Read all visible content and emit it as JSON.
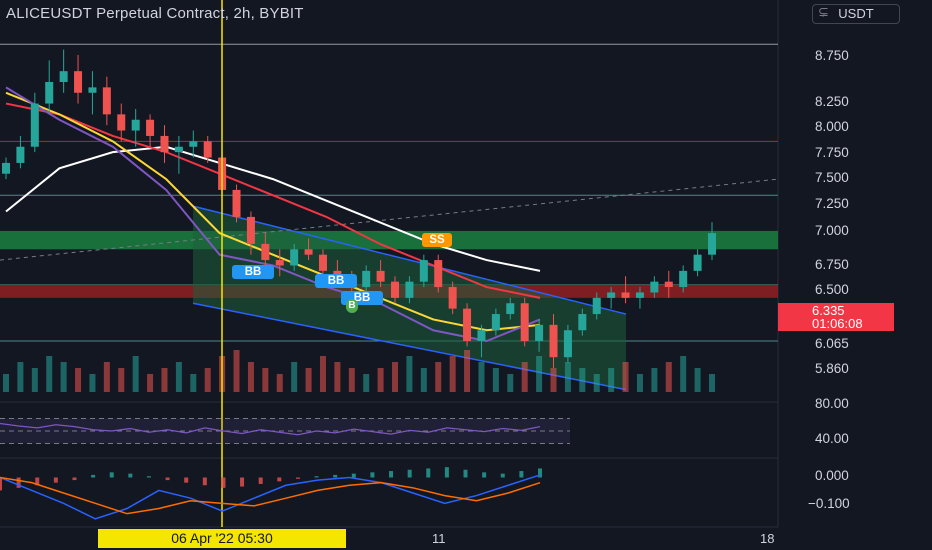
{
  "header": {
    "title": "ALICEUSDT Perpetual Contract, 2h, BYBIT",
    "currency_button": "USDT",
    "axis_corner_glyph": "⊊"
  },
  "chart_data": [
    {
      "type": "candlestick",
      "pane": "price",
      "symbol": "ALICEUSDT",
      "interval": "2h",
      "exchange": "BYBIT",
      "ylim": [
        5.7,
        9.1
      ],
      "yticks": [
        "8.750",
        "8.250",
        "8.000",
        "7.750",
        "7.500",
        "7.250",
        "7.000",
        "6.750",
        "6.500",
        "6.065",
        "5.860"
      ],
      "current_price": "6.335",
      "countdown": "01:06:08",
      "candles": [
        [
          7.75,
          7.9,
          7.7,
          7.85
        ],
        [
          7.85,
          8.1,
          7.8,
          8.0
        ],
        [
          8.0,
          8.5,
          7.95,
          8.4
        ],
        [
          8.4,
          8.8,
          8.3,
          8.6
        ],
        [
          8.6,
          8.9,
          8.5,
          8.7
        ],
        [
          8.7,
          8.85,
          8.4,
          8.5
        ],
        [
          8.5,
          8.7,
          8.3,
          8.55
        ],
        [
          8.55,
          8.65,
          8.2,
          8.3
        ],
        [
          8.3,
          8.4,
          8.05,
          8.15
        ],
        [
          8.15,
          8.35,
          8.0,
          8.25
        ],
        [
          8.25,
          8.3,
          8.0,
          8.1
        ],
        [
          8.1,
          8.2,
          7.85,
          7.95
        ],
        [
          7.95,
          8.1,
          7.75,
          8.0
        ],
        [
          8.0,
          8.15,
          7.9,
          8.05
        ],
        [
          8.05,
          8.1,
          7.85,
          7.9
        ],
        [
          7.9,
          7.95,
          7.55,
          7.6
        ],
        [
          7.6,
          7.65,
          7.3,
          7.35
        ],
        [
          7.35,
          7.4,
          7.0,
          7.1
        ],
        [
          7.1,
          7.2,
          6.85,
          6.95
        ],
        [
          6.95,
          7.05,
          6.8,
          6.9
        ],
        [
          6.9,
          7.1,
          6.85,
          7.05
        ],
        [
          7.05,
          7.15,
          6.95,
          7.0
        ],
        [
          7.0,
          7.05,
          6.8,
          6.85
        ],
        [
          6.85,
          6.95,
          6.7,
          6.75
        ],
        [
          6.75,
          6.85,
          6.6,
          6.7
        ],
        [
          6.7,
          6.9,
          6.65,
          6.85
        ],
        [
          6.85,
          6.95,
          6.7,
          6.75
        ],
        [
          6.75,
          6.8,
          6.55,
          6.6
        ],
        [
          6.6,
          6.8,
          6.55,
          6.75
        ],
        [
          6.75,
          7.0,
          6.7,
          6.95
        ],
        [
          6.95,
          7.0,
          6.65,
          6.7
        ],
        [
          6.7,
          6.75,
          6.45,
          6.5
        ],
        [
          6.5,
          6.55,
          6.15,
          6.2
        ],
        [
          6.2,
          6.35,
          6.05,
          6.3
        ],
        [
          6.3,
          6.5,
          6.25,
          6.45
        ],
        [
          6.45,
          6.6,
          6.4,
          6.55
        ],
        [
          6.55,
          6.6,
          6.15,
          6.2
        ],
        [
          6.2,
          6.4,
          6.1,
          6.35
        ],
        [
          6.35,
          6.45,
          5.95,
          6.05
        ],
        [
          6.05,
          6.35,
          6.0,
          6.3
        ],
        [
          6.3,
          6.5,
          6.25,
          6.45
        ],
        [
          6.45,
          6.65,
          6.4,
          6.6
        ],
        [
          6.6,
          6.7,
          6.5,
          6.65
        ],
        [
          6.65,
          6.8,
          6.55,
          6.6
        ],
        [
          6.6,
          6.7,
          6.5,
          6.65
        ],
        [
          6.65,
          6.8,
          6.6,
          6.75
        ],
        [
          6.75,
          6.85,
          6.6,
          6.7
        ],
        [
          6.7,
          6.9,
          6.65,
          6.85
        ],
        [
          6.85,
          7.05,
          6.8,
          7.0
        ],
        [
          7.0,
          7.3,
          6.95,
          7.2
        ]
      ],
      "moving_averages": [
        {
          "color": "#ffffff",
          "values": [
            7.4,
            7.8,
            7.95,
            8.0,
            7.85,
            7.7,
            7.5,
            7.3,
            7.1,
            6.95,
            6.85
          ]
        },
        {
          "color": "#f23645",
          "values": [
            8.4,
            8.3,
            8.1,
            7.95,
            7.75,
            7.55,
            7.35,
            7.1,
            6.9,
            6.7,
            6.6
          ]
        },
        {
          "color": "#fdd835",
          "values": [
            8.5,
            8.3,
            8.05,
            7.7,
            7.2,
            7.0,
            6.8,
            6.6,
            6.4,
            6.3,
            6.35
          ]
        },
        {
          "color": "#7e57c2",
          "values": [
            8.55,
            8.25,
            8.0,
            7.6,
            7.0,
            6.9,
            6.7,
            6.55,
            6.3,
            6.2,
            6.4
          ]
        }
      ],
      "signals": [
        {
          "label": "BB",
          "kind": "buy"
        },
        {
          "label": "BB",
          "kind": "buy"
        },
        {
          "label": "BB",
          "kind": "buy"
        },
        {
          "label": "B",
          "kind": "buy"
        },
        {
          "label": "SS",
          "kind": "sell"
        }
      ],
      "zones": [
        {
          "kind": "resistance",
          "from": 7.05,
          "to": 7.22,
          "color": "#1b7a3e"
        },
        {
          "kind": "support",
          "from": 6.6,
          "to": 6.72,
          "color": "#8b1e22"
        }
      ],
      "horizontal_lines": [
        8.05,
        7.55,
        6.72,
        6.2
      ],
      "volumes": [
        3,
        5,
        4,
        6,
        5,
        4,
        3,
        5,
        4,
        6,
        3,
        4,
        5,
        3,
        4,
        6,
        7,
        5,
        4,
        3,
        5,
        4,
        6,
        5,
        4,
        3,
        4,
        5,
        6,
        4,
        5,
        6,
        7,
        5,
        4,
        3,
        5,
        6,
        4,
        5,
        4,
        3,
        4,
        5,
        3,
        4,
        5,
        6,
        4,
        3
      ]
    },
    {
      "type": "line",
      "pane": "rsi",
      "yticks": [
        "80.00",
        "40.00"
      ],
      "levels": [
        70,
        50,
        30
      ],
      "ylim": [
        10,
        90
      ],
      "values": [
        62,
        58,
        55,
        60,
        57,
        52,
        50,
        54,
        48,
        52,
        47,
        55,
        50,
        46,
        52,
        48,
        44,
        50,
        47,
        53,
        49,
        45,
        51,
        48,
        55,
        52,
        49,
        54,
        51,
        57
      ]
    },
    {
      "type": "bar",
      "pane": "macd",
      "yticks": [
        "0.000",
        "−0.100"
      ],
      "ylim": [
        -0.18,
        0.06
      ],
      "histogram": [
        -0.05,
        -0.04,
        -0.03,
        -0.02,
        -0.01,
        0.01,
        0.02,
        0.015,
        0.005,
        -0.01,
        -0.02,
        -0.03,
        -0.04,
        -0.035,
        -0.025,
        -0.015,
        -0.005,
        0.005,
        0.01,
        0.015,
        0.02,
        0.025,
        0.03,
        0.035,
        0.04,
        0.03,
        0.02,
        0.015,
        0.025,
        0.035
      ],
      "series": [
        {
          "color": "#2962ff",
          "values": [
            0.0,
            -0.05,
            -0.1,
            -0.16,
            -0.12,
            -0.05,
            -0.08,
            -0.13,
            -0.08,
            -0.03,
            -0.01,
            0.0,
            -0.02,
            -0.06,
            -0.1,
            -0.07,
            -0.03,
            0.01
          ]
        },
        {
          "color": "#ff6d00",
          "values": [
            0.0,
            -0.02,
            -0.06,
            -0.1,
            -0.14,
            -0.12,
            -0.09,
            -0.1,
            -0.11,
            -0.08,
            -0.05,
            -0.03,
            -0.02,
            -0.04,
            -0.07,
            -0.09,
            -0.06,
            -0.02
          ]
        }
      ]
    }
  ],
  "xaxis": {
    "ticks": [
      "11",
      "18"
    ],
    "crosshair_label": "06 Apr '22    05:30"
  }
}
